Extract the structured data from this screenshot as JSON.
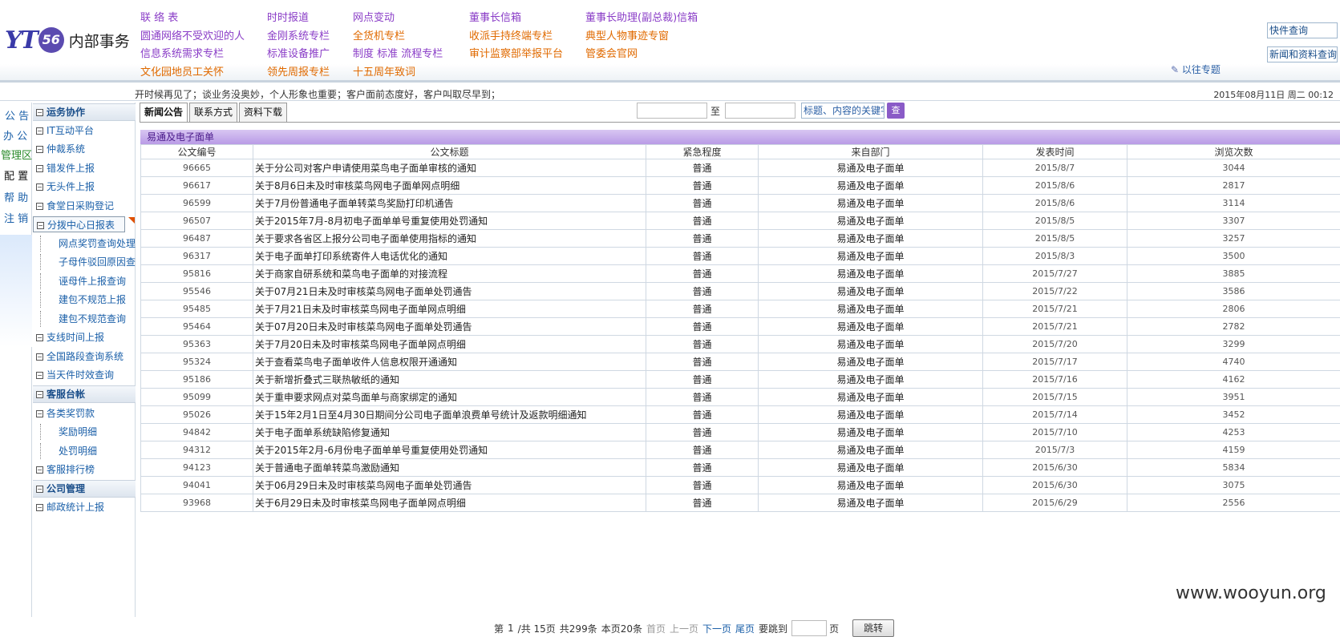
{
  "header": {
    "logo_mark": "YT",
    "logo_ring": "56",
    "logo_title": "内部事务",
    "nav": {
      "col1": [
        "联 络 表",
        "圆通网络不受欢迎的人",
        "信息系统需求专栏",
        "文化园地员工关怀"
      ],
      "col2": [
        "时时报道",
        "金刚系统专栏",
        "标准设备推广",
        "领先周报专栏"
      ],
      "col3": [
        "网点变动",
        "全货机专栏",
        "制度 标准 流程专栏",
        "十五周年致词"
      ],
      "col4": [
        "董事长信箱",
        "收派手持终端专栏",
        "审计监察部举报平台"
      ],
      "col5": [
        "董事长助理(副总裁)信箱",
        "典型人物事迹专窗",
        "管委会官网"
      ]
    },
    "quick_query": "快件查询",
    "news_query": "新闻和资料查询",
    "old_topics": "以往专题"
  },
  "statusbar": {
    "marquee": "开时候再见了；谈业务没奥妙，个人形象也重要；客户面前态度好，客户叫取尽早到；",
    "datetime": "2015年08月11日  周二  00:12"
  },
  "lefttabs": [
    "公 告",
    "办 公",
    "管理区",
    "配 置",
    "帮 助",
    "注 销"
  ],
  "sidemenu": {
    "sections": [
      "运务协作",
      "客服台帐",
      "公司管理"
    ],
    "items": [
      {
        "label": "IT互动平台",
        "sub": false
      },
      {
        "label": "仲裁系统",
        "sub": false
      },
      {
        "label": "错发件上报",
        "sub": false
      },
      {
        "label": "无头件上报",
        "sub": false
      },
      {
        "label": "食堂日采购登记",
        "sub": false
      },
      {
        "label": "分拨中心日报表",
        "sub": false
      },
      {
        "label": "网点奖罚查询处理",
        "sub": true
      },
      {
        "label": "子母件驳回原因查",
        "sub": true
      },
      {
        "label": "诬母件上报查询",
        "sub": true
      },
      {
        "label": "建包不规范上报",
        "sub": true
      },
      {
        "label": "建包不规范查询",
        "sub": true
      },
      {
        "label": "支线时间上报",
        "sub": false
      },
      {
        "label": "全国路段查询系统",
        "sub": false
      },
      {
        "label": "当天件时效查询",
        "sub": false
      },
      {
        "label": "各类奖罚款",
        "sub": false
      },
      {
        "label": "奖励明细",
        "sub": true
      },
      {
        "label": "处罚明细",
        "sub": true
      },
      {
        "label": "客服排行榜",
        "sub": false
      },
      {
        "label": "邮政统计上报",
        "sub": false
      }
    ]
  },
  "main": {
    "tabs": [
      "新闻公告",
      "联系方式",
      "资料下载"
    ],
    "search_to": "至",
    "keyword_placeholder": "标题、内容的关键字",
    "search_button": "查",
    "panel_title": "易通及电子面单",
    "columns": [
      "公文编号",
      "公文标题",
      "紧急程度",
      "来自部门",
      "发表时间",
      "浏览次数"
    ],
    "rows": [
      [
        "96665",
        "关于分公司对客户申请使用菜鸟电子面单审核的通知",
        "普通",
        "易通及电子面单",
        "2015/8/7",
        "3044"
      ],
      [
        "96617",
        "关于8月6日未及时审核菜鸟网电子面单网点明细",
        "普通",
        "易通及电子面单",
        "2015/8/6",
        "2817"
      ],
      [
        "96599",
        "关于7月份普通电子面单转菜鸟奖励打印机通告",
        "普通",
        "易通及电子面单",
        "2015/8/6",
        "3114"
      ],
      [
        "96507",
        "关于2015年7月-8月初电子面单单号重复使用处罚通知",
        "普通",
        "易通及电子面单",
        "2015/8/5",
        "3307"
      ],
      [
        "96487",
        "关于要求各省区上报分公司电子面单使用指标的通知",
        "普通",
        "易通及电子面单",
        "2015/8/5",
        "3257"
      ],
      [
        "96317",
        "关于电子面单打印系统寄件人电话优化的通知",
        "普通",
        "易通及电子面单",
        "2015/8/3",
        "3500"
      ],
      [
        "95816",
        "关于商家自研系统和菜鸟电子面单的对接流程",
        "普通",
        "易通及电子面单",
        "2015/7/27",
        "3885"
      ],
      [
        "95546",
        "关于07月21日未及时审核菜鸟网电子面单处罚通告",
        "普通",
        "易通及电子面单",
        "2015/7/22",
        "3586"
      ],
      [
        "95485",
        "关于7月21日未及时审核菜鸟网电子面单网点明细",
        "普通",
        "易通及电子面单",
        "2015/7/21",
        "2806"
      ],
      [
        "95464",
        "关于07月20日未及时审核菜鸟网电子面单处罚通告",
        "普通",
        "易通及电子面单",
        "2015/7/21",
        "2782"
      ],
      [
        "95363",
        "关于7月20日未及时审核菜鸟网电子面单网点明细",
        "普通",
        "易通及电子面单",
        "2015/7/20",
        "3299"
      ],
      [
        "95324",
        "关于查看菜鸟电子面单收件人信息权限开通通知",
        "普通",
        "易通及电子面单",
        "2015/7/17",
        "4740"
      ],
      [
        "95186",
        "关于新增折叠式三联热敏纸的通知",
        "普通",
        "易通及电子面单",
        "2015/7/16",
        "4162"
      ],
      [
        "95099",
        "关于重申要求网点对菜鸟面单与商家绑定的通知",
        "普通",
        "易通及电子面单",
        "2015/7/15",
        "3951"
      ],
      [
        "95026",
        "关于15年2月1日至4月30日期间分公司电子面单浪费单号统计及返款明细通知",
        "普通",
        "易通及电子面单",
        "2015/7/14",
        "3452"
      ],
      [
        "94842",
        "关于电子面单系统缺陷修复通知",
        "普通",
        "易通及电子面单",
        "2015/7/10",
        "4253"
      ],
      [
        "94312",
        "关于2015年2月-6月份电子面单单号重复使用处罚通知",
        "普通",
        "易通及电子面单",
        "2015/7/3",
        "4159"
      ],
      [
        "94123",
        "关于普通电子面单转菜鸟激励通知",
        "普通",
        "易通及电子面单",
        "2015/6/30",
        "5834"
      ],
      [
        "94041",
        "关于06月29日未及时审核菜鸟网电子面单处罚通告",
        "普通",
        "易通及电子面单",
        "2015/6/30",
        "3075"
      ],
      [
        "93968",
        "关于6月29日未及时审核菜鸟网电子面单网点明细",
        "普通",
        "易通及电子面单",
        "2015/6/29",
        "2556"
      ]
    ],
    "pager": {
      "page_prefix": "第",
      "current": "1",
      "total_pages": "/共  15页",
      "total_items": "共299条",
      "per_page": "本页20条",
      "first": "首页",
      "prev": "上一页",
      "next": "下一页",
      "last": "尾页",
      "jump_label": "要跳到",
      "page_unit": "页",
      "jump_button": "跳转"
    }
  },
  "watermark": "www.wooyun.org"
}
